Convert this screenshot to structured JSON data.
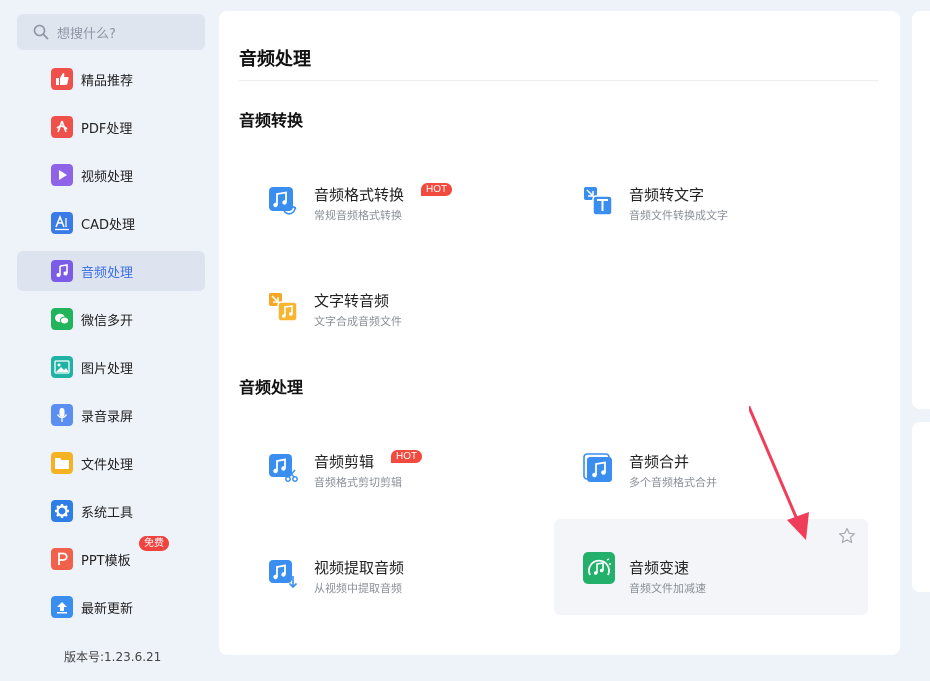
{
  "search": {
    "placeholder": "想搜什么?"
  },
  "sidebar": {
    "items": [
      {
        "label": "精品推荐",
        "icon": "thumbs-up-icon",
        "color": "#f0504a"
      },
      {
        "label": "PDF处理",
        "icon": "pdf-icon",
        "color": "#f0504a"
      },
      {
        "label": "视频处理",
        "icon": "play-icon",
        "color": "#8f63e8"
      },
      {
        "label": "CAD处理",
        "icon": "cad-icon",
        "color": "#3a7be8"
      },
      {
        "label": "音频处理",
        "icon": "music-note-icon",
        "color": "#7a5ce6"
      },
      {
        "label": "微信多开",
        "icon": "wechat-icon",
        "color": "#22b45a"
      },
      {
        "label": "图片处理",
        "icon": "image-icon",
        "color": "#1fb3a5"
      },
      {
        "label": "录音录屏",
        "icon": "microphone-icon",
        "color": "#5a8ef0"
      },
      {
        "label": "文件处理",
        "icon": "folder-icon",
        "color": "#f5b324"
      },
      {
        "label": "系统工具",
        "icon": "gear-icon",
        "color": "#2f7de6"
      },
      {
        "label": "PPT模板",
        "icon": "ppt-icon",
        "color": "#f0604a",
        "badge": "免费"
      },
      {
        "label": "最新更新",
        "icon": "upload-icon",
        "color": "#3a8ef0"
      }
    ],
    "version": "版本号:1.23.6.21"
  },
  "main": {
    "title": "音频处理",
    "sections": [
      {
        "title": "音频转换",
        "tools": [
          {
            "name": "音频格式转换",
            "desc": "常规音频格式转换",
            "badge": "HOT",
            "icon": "audio-convert-icon"
          },
          {
            "name": "音频转文字",
            "desc": "音频文件转换成文字",
            "icon": "audio-to-text-icon"
          },
          {
            "name": "文字转音频",
            "desc": "文字合成音频文件",
            "icon": "text-to-audio-icon"
          }
        ]
      },
      {
        "title": "音频处理",
        "tools": [
          {
            "name": "音频剪辑",
            "desc": "音频格式剪切剪辑",
            "badge": "HOT",
            "icon": "audio-cut-icon"
          },
          {
            "name": "音频合并",
            "desc": "多个音频格式合并",
            "icon": "audio-merge-icon"
          },
          {
            "name": "视频提取音频",
            "desc": "从视频中提取音频",
            "icon": "video-extract-audio-icon"
          },
          {
            "name": "音频变速",
            "desc": "音频文件加减速",
            "icon": "audio-speed-icon"
          }
        ]
      }
    ]
  },
  "colors": {
    "accent": "#3a6fe6",
    "hot": "#f24a3f",
    "arrow": "#f03e5a",
    "bg": "#eef2f9"
  }
}
